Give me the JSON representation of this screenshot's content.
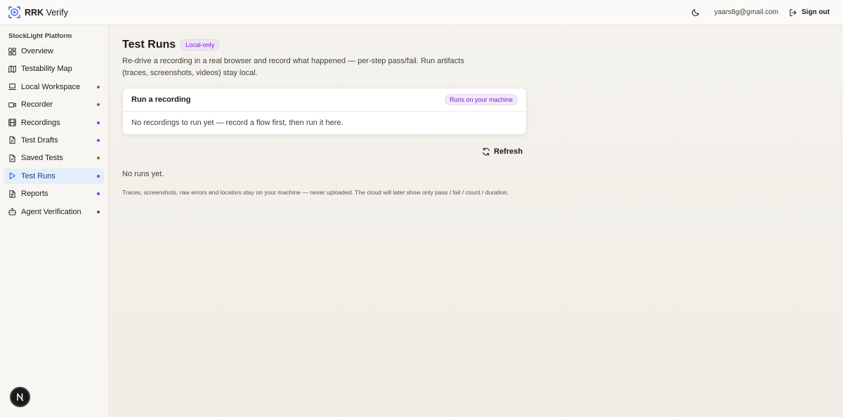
{
  "header": {
    "brand_bold": "RRK",
    "brand_rest": "Verify",
    "user_email": "yaars8g@gmail.com",
    "signout_label": "Sign out",
    "theme_icon": "moon-icon"
  },
  "sidebar": {
    "group_label": "StockLight Platform",
    "items": [
      {
        "label": "Overview",
        "icon": "grid-icon",
        "dot": null
      },
      {
        "label": "Testability Map",
        "icon": "map-icon",
        "dot": null
      },
      {
        "label": "Local Workspace",
        "icon": "laptop-icon",
        "dot": "#a16207"
      },
      {
        "label": "Recorder",
        "icon": "video-icon",
        "dot": "#a16207"
      },
      {
        "label": "Recordings",
        "icon": "film-icon",
        "dot": "#7c3aed"
      },
      {
        "label": "Test Drafts",
        "icon": "file-icon",
        "dot": "#7c3aed"
      },
      {
        "label": "Saved Tests",
        "icon": "file-check-icon",
        "dot": "#a16207"
      },
      {
        "label": "Test Runs",
        "icon": "play-icon",
        "dot": "#7c3aed",
        "active": true
      },
      {
        "label": "Reports",
        "icon": "report-icon",
        "dot": "#7c3aed"
      },
      {
        "label": "Agent Verification",
        "icon": "bot-icon",
        "dot": "#57534e"
      }
    ],
    "avatar_letter": "N"
  },
  "main": {
    "title": "Test Runs",
    "title_badge": "Local-only",
    "description": "Re-drive a recording in a real browser and record what happened — per-step pass/fail. Run artifacts (traces, screenshots, videos) stay local.",
    "card": {
      "title": "Run a recording",
      "badge": "Runs on your machine",
      "body": "No recordings to run yet — record a flow first, then run it here."
    },
    "refresh_label": "Refresh",
    "empty_text": "No runs yet.",
    "footnote": "Traces, screenshots, raw errors and locators stay on your machine — never uploaded. The cloud will later show only pass / fail / count / duration."
  },
  "colors": {
    "accent_purple": "#7e22ce",
    "active_bg": "#e3eefb",
    "dot_amber": "#a16207",
    "dot_violet": "#7c3aed"
  }
}
